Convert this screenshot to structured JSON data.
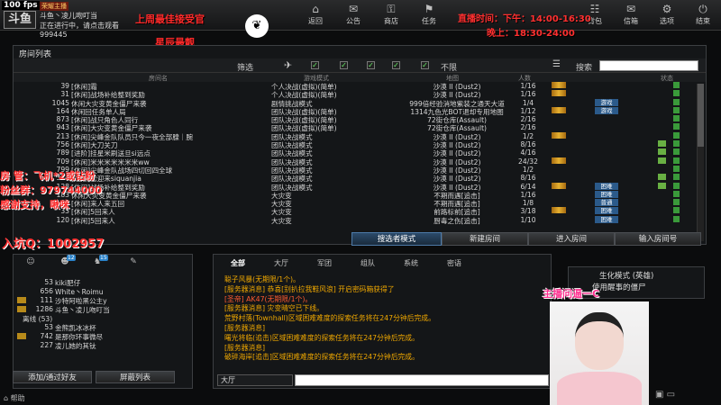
{
  "status": {
    "fps": "100 fps"
  },
  "logo": "斗鱼",
  "user": {
    "line1_tag": "荣耀主播",
    "line1": "斗鱼丶凌儿吻叮当",
    "line2": "正在进行中，请点击观看",
    "exp": "999445"
  },
  "overlay": {
    "room_title": "上周最佳接受官",
    "room_sub": "星辰最靓",
    "live_time_label": "直播时间：下午：14:00-16:30",
    "evening": "晚上：18:30-24:00",
    "manager": "房 管：飞机*2或钻粉",
    "fans": "粉丝群：979744000",
    "thanks": "感谢支持，啾咪",
    "qq": "入坑Q：1002957",
    "streamer": "主播问逼一C"
  },
  "nav": [
    {
      "icon": "⌂",
      "label": "返回"
    },
    {
      "icon": "✉",
      "label": "公告"
    },
    {
      "icon": "⚿",
      "label": "商店"
    },
    {
      "icon": "⚑",
      "label": "任务"
    },
    {
      "icon": "☷",
      "label": "背包"
    },
    {
      "icon": "✉",
      "label": "信箱"
    },
    {
      "icon": "⚙",
      "label": "选项"
    },
    {
      "icon": "⏻",
      "label": "结束"
    }
  ],
  "roomlist": {
    "title": "房间列表",
    "filter_label": "筛选",
    "no_limit": "不限",
    "search_label": "搜索",
    "headers": [
      "房间名",
      "游戏模式",
      "地图",
      "人数",
      "状态"
    ],
    "rows": [
      {
        "no": "39",
        "name": "[休闲]霜",
        "mode": "个人决战(虚拟)(简单)",
        "map": "沙漠 II (Dust2)",
        "cnt": "1/16",
        "badge": "",
        "st": false
      },
      {
        "no": "31",
        "name": "[休闲]战场补给整到奖励",
        "mode": "个人决战(虚拟)(简单)",
        "map": "沙漠 II (Dust2)",
        "cnt": "1/16",
        "badge": "",
        "st": false
      },
      {
        "no": "1045",
        "name": "休闲大灾变黄金僵尸来袭",
        "mode": "剧情挑战模式",
        "map": "999倍经验消地紫装之通天大道",
        "cnt": "1/4",
        "badge": "游戏",
        "st": false
      },
      {
        "no": "164",
        "name": "休闲回任务单人局",
        "mode": "团队决战(虚拟)(简单)",
        "map": "1314九色光BOT退却专用地图",
        "cnt": "1/12",
        "badge": "游戏",
        "st": false
      },
      {
        "no": "873",
        "name": "[休闲]战只角色人同行",
        "mode": "团队决战(虚拟)(简单)",
        "map": "72街仓库(Assault)",
        "cnt": "2/16",
        "badge": "",
        "st": false
      },
      {
        "no": "943",
        "name": "[休闲]大灾变黄金僵尸来袭",
        "mode": "团队决战(虚拟)(简单)",
        "map": "72街仓库(Assault)",
        "cnt": "2/16",
        "badge": "",
        "st": false
      },
      {
        "no": "213",
        "name": "[休闲]尖峰金队队员只今一夜全部腺｜腕",
        "mode": "团队决战模式",
        "map": "沙漠 II (Dust2)",
        "cnt": "1/2",
        "badge": "",
        "st": false
      },
      {
        "no": "756",
        "name": "[休闲]大刀关刀",
        "mode": "团队决战模式",
        "map": "沙漠 II (Dust2)",
        "cnt": "8/16",
        "badge": "",
        "st": true
      },
      {
        "no": "789",
        "name": "[进阶]挂星米刷送旦si远点",
        "mode": "团队决战模式",
        "map": "沙漠 II (Dust2)",
        "cnt": "4/16",
        "badge": "",
        "st": true
      },
      {
        "no": "709",
        "name": "[休闲]米米米米米米米ww",
        "mode": "团队决战模式",
        "map": "沙漠 II (Dust2)",
        "cnt": "24/32",
        "badge": "",
        "st": true
      },
      {
        "no": "799",
        "name": "[休闲]尖峰金队战场四切回四全球",
        "mode": "团队决战模式",
        "map": "沙漠 II (Dust2)",
        "cnt": "1/2",
        "badge": "",
        "st": false
      },
      {
        "no": "314",
        "name": "[进阶]松迎来siquanjia",
        "mode": "团队决战模式",
        "map": "沙漠 II (Dust2)",
        "cnt": "8/16",
        "badge": "",
        "st": true
      },
      {
        "no": "128",
        "name": "[休闲]战场补给整到奖励",
        "mode": "团队决战模式",
        "map": "沙漠 II (Dust2)",
        "cnt": "6/14",
        "badge": "困难",
        "st": true
      },
      {
        "no": "183",
        "name": "休闲大灾变黄金僵尸来袭",
        "mode": "大灾变",
        "map": "不期而遇[追击]",
        "cnt": "1/16",
        "badge": "困难",
        "st": false
      },
      {
        "no": "88",
        "name": "[休闲]来人来五回",
        "mode": "大灾变",
        "map": "不期而遇[追击]",
        "cnt": "1/8",
        "badge": "普通",
        "st": false
      },
      {
        "no": "33",
        "name": "[休闲]5回来人",
        "mode": "大灾变",
        "map": "前路标前[追击]",
        "cnt": "3/18",
        "badge": "困难",
        "st": false
      },
      {
        "no": "120",
        "name": "[休闲]5回来人",
        "mode": "大灾变",
        "map": "厨毒之伤[追击]",
        "cnt": "1/10",
        "badge": "困难",
        "st": false
      }
    ]
  },
  "actions": {
    "quick": "搜选者模式",
    "new_room": "新建房间",
    "enter_room": "进入房间",
    "enter_number": "输入房间号"
  },
  "friends": {
    "section": "离线 (53)",
    "list": [
      {
        "lv": "53",
        "name": "kiki肥仔",
        "crown": false
      },
      {
        "lv": "656",
        "name": "White丶Roimu",
        "crown": false
      },
      {
        "lv": "111",
        "name": "沙特阿啦黑公主y",
        "crown": true
      },
      {
        "lv": "1286",
        "name": "斗鱼丶凌儿吻叮当",
        "crown": true
      },
      {
        "lv": "53",
        "name": "金熊凯冰冰杯",
        "crown": false
      },
      {
        "lv": "742",
        "name": "是那你环事微尽",
        "crown": true
      },
      {
        "lv": "227",
        "name": "凌儿她的其钛",
        "crown": false
      }
    ],
    "add_btn": "添加/通过好友",
    "block_btn": "屏蔽列表"
  },
  "chat": {
    "tabs": [
      "全部",
      "大厅",
      "军团",
      "组队",
      "系统",
      "密语"
    ],
    "messages": [
      {
        "c": "m-orange",
        "t": "聪子风暴(无期限/1个)。"
      },
      {
        "c": "m-orange",
        "t": "[服务器消息] 恭喜[别扒拉我鞋风浪] 开启密码箱获得了"
      },
      {
        "c": "m-hl",
        "t": "[圣帝] AK47(无期限/1个)。"
      },
      {
        "c": "m-orange",
        "t": "[服务器消息] 灾变晴空已下线。"
      },
      {
        "c": "m-orange",
        "t": "荒野村落(Townhall)区域困难难度的探索任务将在247分钟后完成。"
      },
      {
        "c": "m-orange",
        "t": "[服务器消息]"
      },
      {
        "c": "m-orange",
        "t": "曙光将临(追击)区域困难难度的探索任务将在247分钟后完成。"
      },
      {
        "c": "m-orange",
        "t": "[服务器消息]"
      },
      {
        "c": "m-orange",
        "t": "破碎海岸[追击]区域困难难度的探索任务将在247分钟后完成。"
      }
    ],
    "channel": "大厅"
  },
  "ad": {
    "title": "生化模式 (英雄)",
    "sub": "使用醒事的僵尸"
  },
  "bottom": {
    "help": "帮助"
  }
}
